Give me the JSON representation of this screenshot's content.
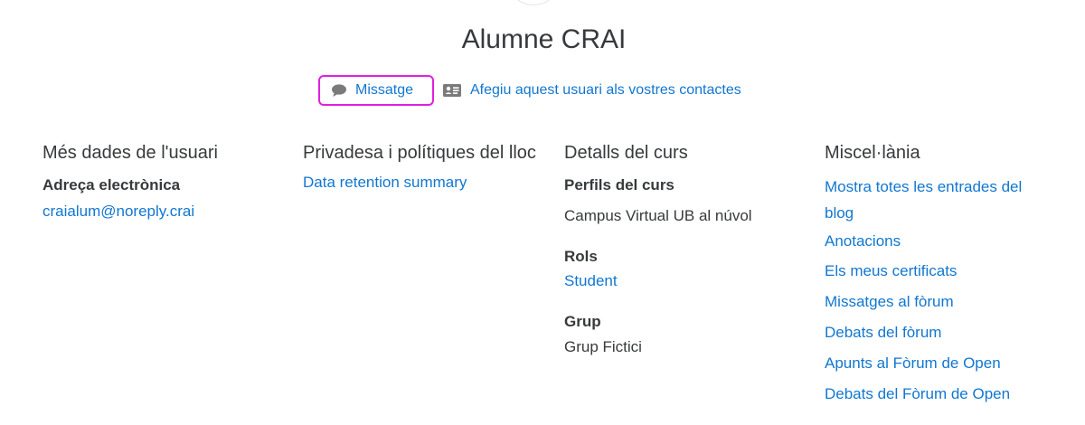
{
  "profile": {
    "name": "Alumne CRAI"
  },
  "actions": {
    "message_label": "Missatge",
    "add_contact_label": "Afegiu aquest usuari als vostres contactes"
  },
  "user_details": {
    "heading": "Més dades de l'usuari",
    "email_label": "Adreça electrònica",
    "email_value": "craialum@noreply.crai"
  },
  "privacy": {
    "heading": "Privadesa i polítiques del lloc",
    "link": "Data retention summary"
  },
  "course_details": {
    "heading": "Detalls del curs",
    "profiles_label": "Perfils del curs",
    "profiles_value": "Campus Virtual UB al núvol",
    "roles_label": "Rols",
    "roles_value": "Student",
    "group_label": "Grup",
    "group_value": "Grup Fictici"
  },
  "misc": {
    "heading": "Miscel·lània",
    "links": [
      "Mostra totes les entrades del blog",
      "Anotacions",
      "Els meus certificats",
      "Missatges al fòrum",
      "Debats del fòrum",
      "Apunts al Fòrum de Open",
      "Debats del Fòrum de Open"
    ]
  },
  "colors": {
    "link": "#1177d1",
    "text": "#373a3c",
    "highlight": "#e020e0"
  }
}
